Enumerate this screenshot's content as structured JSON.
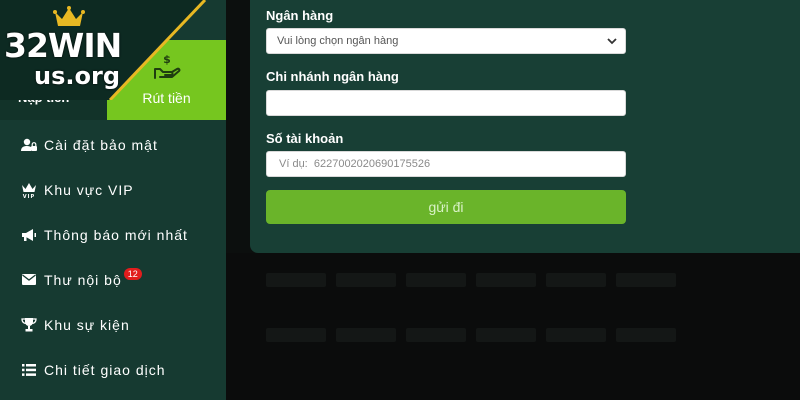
{
  "logo": {
    "main": "32WIN",
    "sub": "us.org"
  },
  "tabs": {
    "deposit_label": "Nạp tiền",
    "withdraw_label": "Rút tiền"
  },
  "menu": {
    "items": [
      {
        "label": "Cài đặt bảo mật",
        "icon": "user-lock-icon"
      },
      {
        "label": "Khu vực VIP",
        "icon": "vip-crown-icon"
      },
      {
        "label": "Thông báo mới nhất",
        "icon": "megaphone-icon"
      },
      {
        "label": "Thư nội bộ",
        "icon": "envelope-icon",
        "badge": "12"
      },
      {
        "label": "Khu sự kiện",
        "icon": "trophy-icon"
      },
      {
        "label": "Chi tiết giao dịch",
        "icon": "list-icon"
      }
    ]
  },
  "form": {
    "bank_label": "Ngân hàng",
    "bank_select_value": "Vui lòng chọn ngân hàng",
    "branch_label": "Chi nhánh ngân hàng",
    "branch_value": "",
    "account_label": "Số tài khoản",
    "account_placeholder": "Ví dụ:  6227002020690175526",
    "submit_label": "gửi đi"
  },
  "colors": {
    "sidebar": "#163a31",
    "accent_green": "#76c61f",
    "panel": "#183f35",
    "button": "#6ab42a",
    "badge": "#e21d1d",
    "logo_gold": "#e8b823"
  }
}
